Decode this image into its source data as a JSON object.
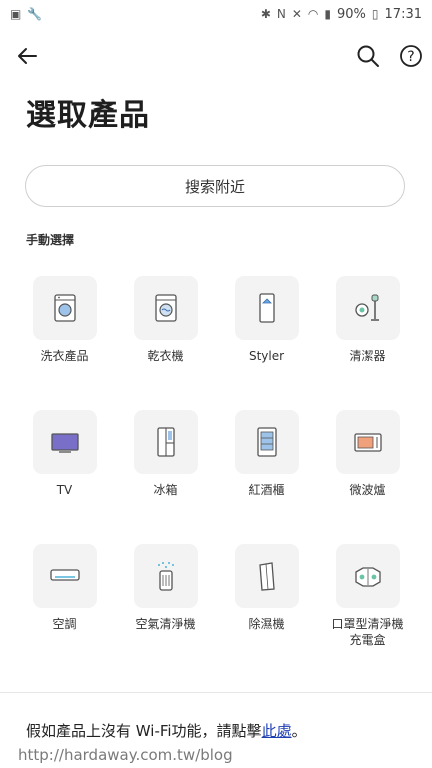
{
  "status": {
    "battery": "90%",
    "time": "17:31"
  },
  "page": {
    "title": "選取產品"
  },
  "nearby": {
    "label": "搜索附近"
  },
  "section": {
    "manual_label": "手動選擇"
  },
  "products": [
    {
      "label": "洗衣產品",
      "icon": "washer-icon"
    },
    {
      "label": "乾衣機",
      "icon": "dryer-icon"
    },
    {
      "label": "Styler",
      "icon": "styler-icon"
    },
    {
      "label": "清潔器",
      "icon": "vacuum-icon"
    },
    {
      "label": "TV",
      "icon": "tv-icon"
    },
    {
      "label": "冰箱",
      "icon": "fridge-icon"
    },
    {
      "label": "紅酒櫃",
      "icon": "wine-cabinet-icon"
    },
    {
      "label": "微波爐",
      "icon": "microwave-icon"
    },
    {
      "label": "空調",
      "icon": "air-conditioner-icon"
    },
    {
      "label": "空氣清淨機",
      "icon": "air-purifier-icon"
    },
    {
      "label": "除濕機",
      "icon": "dehumidifier-icon"
    },
    {
      "label": "口罩型清淨機\n充電盒",
      "icon": "mask-purifier-icon"
    }
  ],
  "footer": {
    "text": "假如產品上沒有 Wi-Fi功能，請點擊",
    "link": "此處",
    "period": "。"
  },
  "watermark": "http://hardaway.com.tw/blog",
  "colors": {
    "accent": "#1f3fb2",
    "icon_line": "#555555",
    "tile_bg": "#f3f3f3"
  }
}
